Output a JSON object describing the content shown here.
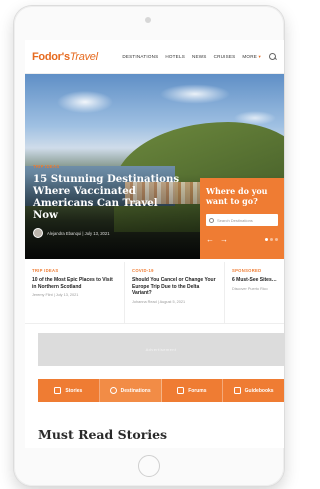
{
  "header": {
    "logo_part1": "Fodor's",
    "logo_part2": "Travel",
    "nav": [
      "DESTINATIONS",
      "HOTELS",
      "NEWS",
      "CRUISES"
    ],
    "more_label": "MORE",
    "more_caret": "▾"
  },
  "hero": {
    "tag": "TRIP IDEAS",
    "headline": "15 Stunning Destinations Where Vaccinated Americans Can Travel Now",
    "byline": "Alejandra Ebanqui | July 13, 2021"
  },
  "where_box": {
    "title": "Where do you want to go?",
    "search_placeholder": "Search Destinations",
    "prev_arrow": "←",
    "next_arrow": "→"
  },
  "cards": [
    {
      "tag": "TRIP IDEAS",
      "title": "10 of the Most Epic Places to Visit in Northern Scotland",
      "meta": "Jeremy Flint | July 13, 2021"
    },
    {
      "tag": "COVID-19",
      "title": "Should You Cancel or Change Your Europe Trip Due to the Delta Variant?",
      "meta": "Johanna Read | August 5, 2021"
    },
    {
      "tag": "SPONSORED",
      "title": "6 Must-See Sites…",
      "meta": "Discover Puerto Rico"
    }
  ],
  "ad": {
    "label": "Advertisement"
  },
  "tabs": [
    {
      "label": "Stories",
      "icon": "pencil-icon"
    },
    {
      "label": "Destinations",
      "icon": "compass-icon"
    },
    {
      "label": "Forums",
      "icon": "chat-icon"
    },
    {
      "label": "Guidebooks",
      "icon": "book-icon"
    }
  ],
  "section_title": "Must Read Stories",
  "colors": {
    "accent": "#ef7c33",
    "headline": "#ffffff",
    "body_text": "#222222"
  }
}
